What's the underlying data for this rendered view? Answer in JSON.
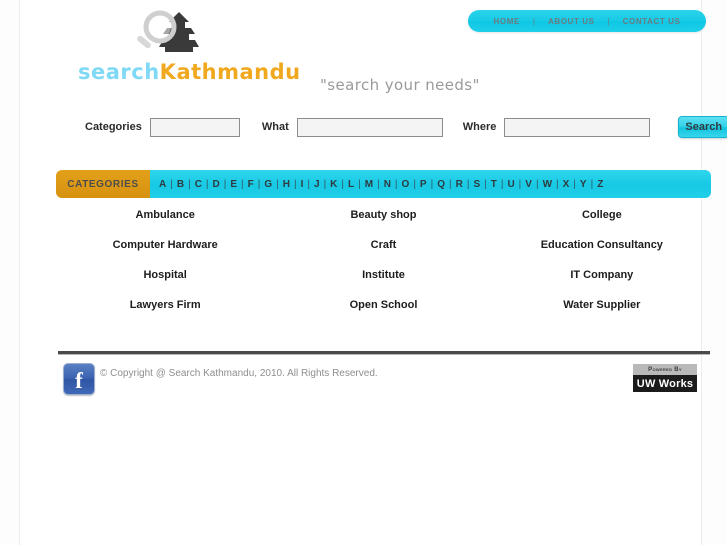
{
  "site": {
    "logo_text_part1": "search",
    "logo_text_part2": "Kathmandu",
    "logo_mark_icon": "magnifier-pagoda-icon",
    "tagline": "\"search your needs\"",
    "colors": {
      "cyan": "#19cbe6",
      "orange": "#d6920f",
      "logo_blue": "#7fd9f5",
      "logo_orange": "#f0a81e",
      "facebook_blue": "#2f55a3"
    }
  },
  "nav": {
    "separator": "|",
    "items": [
      {
        "label": "HOME"
      },
      {
        "label": "ABOUT US"
      },
      {
        "label": "CONTACT US"
      }
    ]
  },
  "search": {
    "fields": [
      {
        "label": "Categories",
        "value": "",
        "placeholder": ""
      },
      {
        "label": "What",
        "value": "",
        "placeholder": ""
      },
      {
        "label": "Where",
        "value": "",
        "placeholder": ""
      }
    ],
    "button_label": "Search"
  },
  "categories_bar": {
    "tab_label": "CATEGORIES",
    "separator": "|",
    "letters": [
      "A",
      "B",
      "C",
      "D",
      "E",
      "F",
      "G",
      "H",
      "I",
      "J",
      "K",
      "L",
      "M",
      "N",
      "O",
      "P",
      "Q",
      "R",
      "S",
      "T",
      "U",
      "V",
      "W",
      "X",
      "Y",
      "Z"
    ]
  },
  "categories": [
    "Ambulance",
    "Beauty shop",
    "College",
    "Computer Hardware",
    "Craft",
    "Education Consultancy",
    "Hospital",
    "Institute",
    "IT Company",
    "Lawyers Firm",
    "Open School",
    "Water Supplier"
  ],
  "footer": {
    "facebook_icon": "facebook-icon",
    "facebook_glyph": "f",
    "copyright": "© Copyright @ Search Kathmandu, 2010. All Rights Reserved.",
    "powered_top": "Powered By",
    "powered_bottom": "UW Works"
  }
}
